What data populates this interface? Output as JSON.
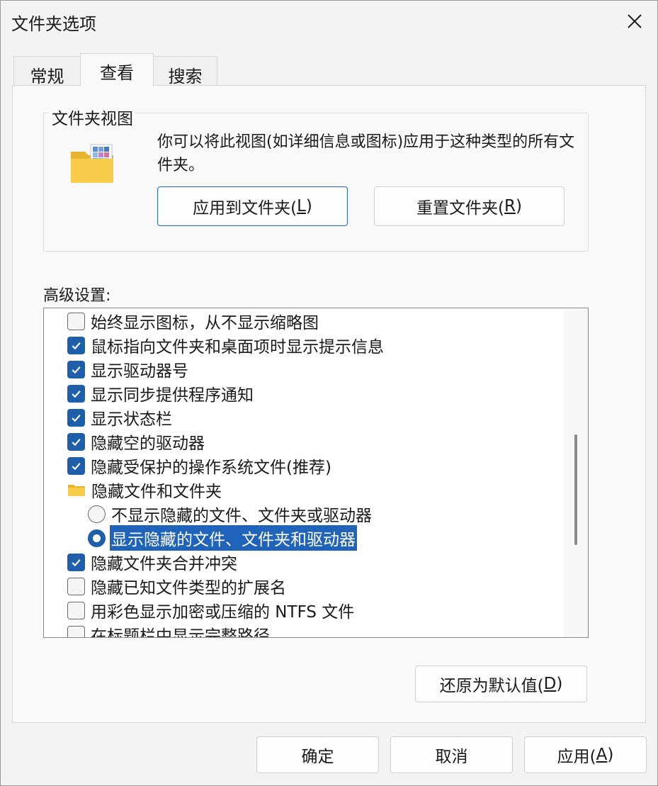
{
  "window": {
    "title": "文件夹选项"
  },
  "tabs": [
    {
      "label": "常规",
      "active": false
    },
    {
      "label": "查看",
      "active": true
    },
    {
      "label": "搜索",
      "active": false
    }
  ],
  "folder_views": {
    "title": "文件夹视图",
    "description": "你可以将此视图(如详细信息或图标)应用于这种类型的所有文件夹。",
    "apply_button": {
      "prefix": "应用到文件夹(",
      "accel": "L",
      "suffix": ")"
    },
    "reset_button": {
      "prefix": "重置文件夹(",
      "accel": "R",
      "suffix": ")"
    }
  },
  "advanced": {
    "label": "高级设置:",
    "items": [
      {
        "type": "checkbox",
        "checked": false,
        "label": "始终显示图标，从不显示缩略图"
      },
      {
        "type": "checkbox",
        "checked": true,
        "label": "鼠标指向文件夹和桌面项时显示提示信息"
      },
      {
        "type": "checkbox",
        "checked": true,
        "label": "显示驱动器号"
      },
      {
        "type": "checkbox",
        "checked": true,
        "label": "显示同步提供程序通知"
      },
      {
        "type": "checkbox",
        "checked": true,
        "label": "显示状态栏"
      },
      {
        "type": "checkbox",
        "checked": true,
        "label": "隐藏空的驱动器"
      },
      {
        "type": "checkbox",
        "checked": true,
        "label": "隐藏受保护的操作系统文件(推荐)"
      },
      {
        "type": "folder",
        "label": "隐藏文件和文件夹"
      },
      {
        "type": "radio",
        "checked": false,
        "label": "不显示隐藏的文件、文件夹或驱动器"
      },
      {
        "type": "radio",
        "checked": true,
        "selected": true,
        "label": "显示隐藏的文件、文件夹和驱动器"
      },
      {
        "type": "checkbox",
        "checked": true,
        "label": "隐藏文件夹合并冲突"
      },
      {
        "type": "checkbox",
        "checked": false,
        "label": "隐藏已知文件类型的扩展名"
      },
      {
        "type": "checkbox",
        "checked": false,
        "label": "用彩色显示加密或压缩的 NTFS 文件"
      },
      {
        "type": "checkbox",
        "checked": false,
        "label": "在标题栏中显示完整路径"
      }
    ],
    "restore_button": {
      "prefix": "还原为默认值(",
      "accel": "D",
      "suffix": ")"
    }
  },
  "footer": {
    "ok": "确定",
    "cancel": "取消",
    "apply": {
      "prefix": "应用(",
      "accel": "A",
      "suffix": ")"
    }
  },
  "colors": {
    "accent": "#1d5faa",
    "selection": "#1f64ba"
  },
  "icons": [
    "close-icon",
    "folder-view-icon",
    "checkbox-check-icon",
    "folder-icon",
    "radio-dot-icon"
  ]
}
